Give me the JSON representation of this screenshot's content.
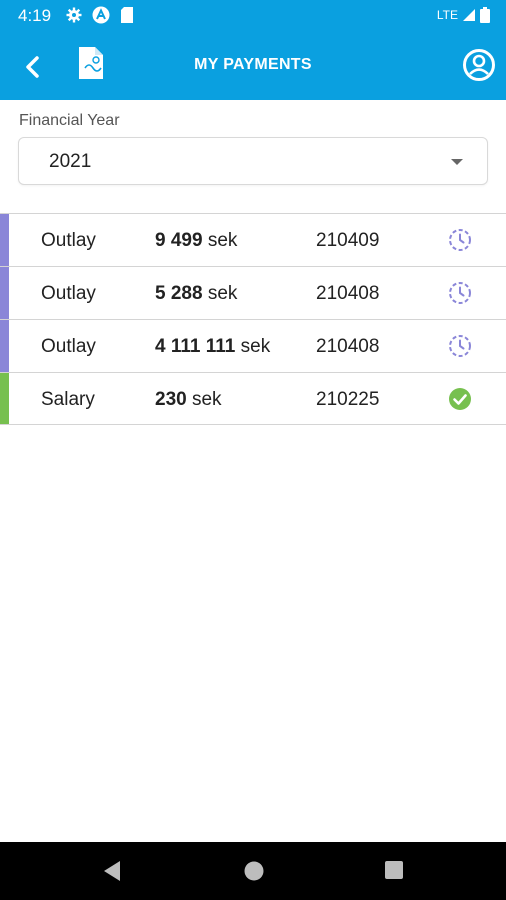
{
  "status": {
    "time": "4:19",
    "network": "LTE"
  },
  "appbar": {
    "title": "MY PAYMENTS"
  },
  "filter": {
    "label": "Financial Year",
    "value": "2021"
  },
  "payments": [
    {
      "type": "Outlay",
      "amount": "9 499",
      "unit": "sek",
      "date": "210409",
      "status": "pending",
      "color": "#8a86d8"
    },
    {
      "type": "Outlay",
      "amount": "5 288",
      "unit": "sek",
      "date": "210408",
      "status": "pending",
      "color": "#8a86d8"
    },
    {
      "type": "Outlay",
      "amount": "4 111 111",
      "unit": "sek",
      "date": "210408",
      "status": "pending",
      "color": "#8a86d8"
    },
    {
      "type": "Salary",
      "amount": "230",
      "unit": "sek",
      "date": "210225",
      "status": "paid",
      "color": "#77c04f"
    }
  ],
  "colors": {
    "primary": "#0aa0e0",
    "pending": "#8a86d8",
    "paid": "#77c04f"
  },
  "icons": {
    "pending": "clock-icon",
    "paid": "check-circle-icon"
  }
}
